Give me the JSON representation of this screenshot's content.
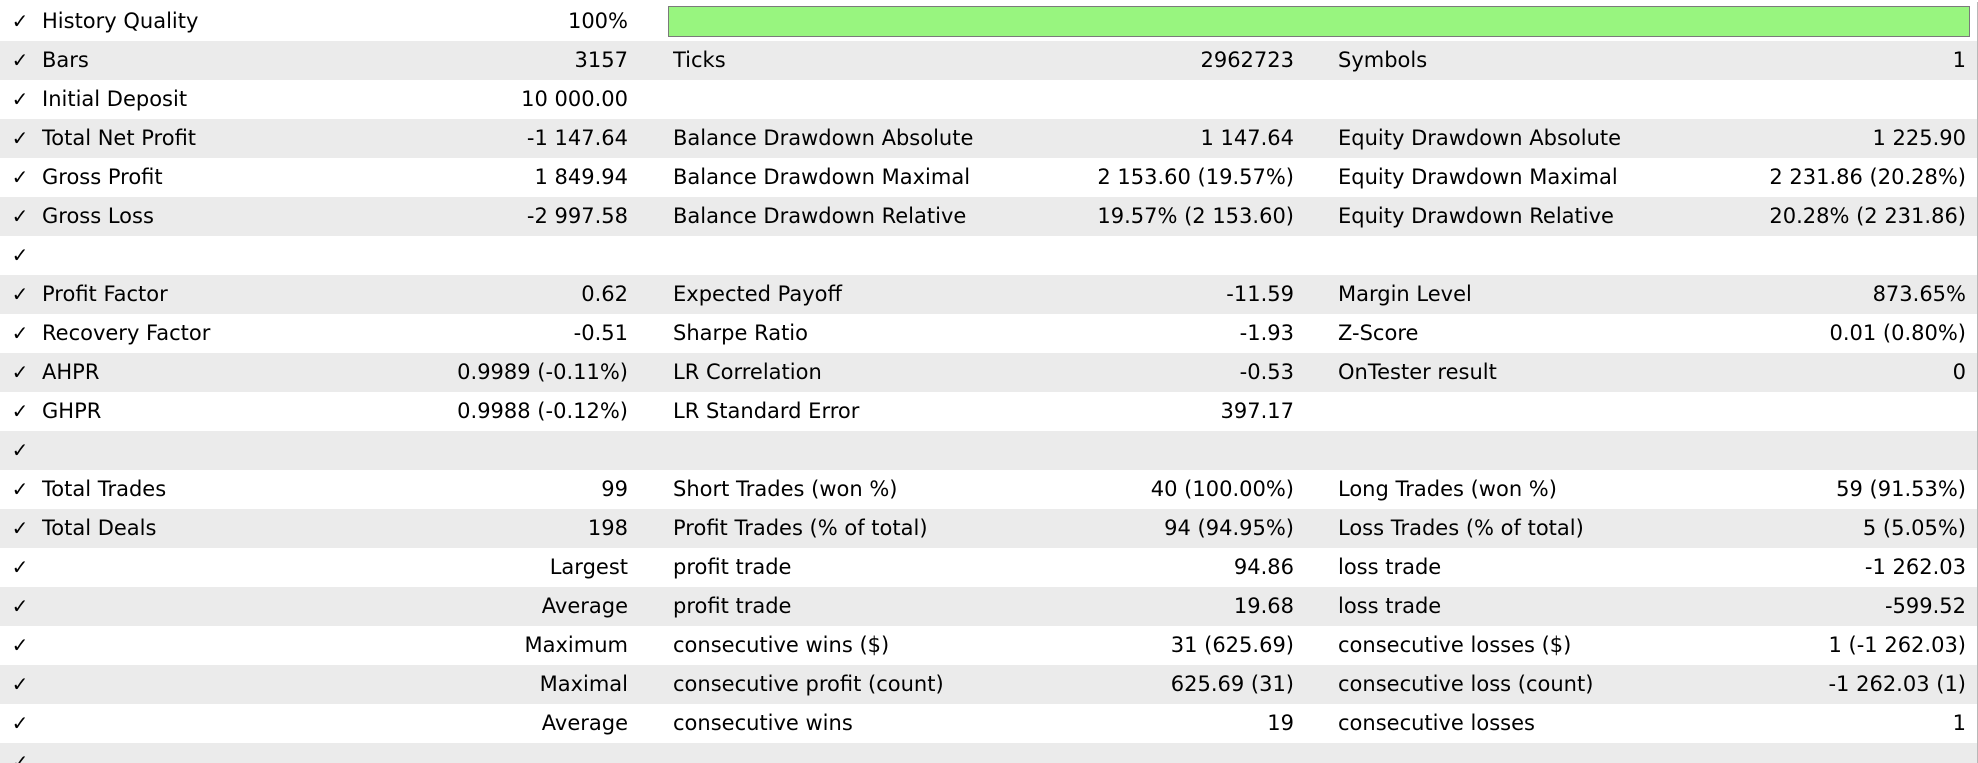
{
  "colors": {
    "row_even": "#ebebeb",
    "row_odd": "#ffffff",
    "quality_fill": "#98f57f"
  },
  "icons": {
    "check": "✓"
  },
  "report": {
    "history_quality": {
      "label": "History Quality",
      "value": "100%",
      "fill_fraction": 1.0
    },
    "bars": {
      "label": "Bars",
      "value": "3157",
      "label2": "Ticks",
      "value2": "2962723",
      "label3": "Symbols",
      "value3": "1"
    },
    "initial_deposit": {
      "label": "Initial Deposit",
      "value": "10 000.00"
    },
    "total_net_profit": {
      "label": "Total Net Profit",
      "value": "-1 147.64",
      "label2": "Balance Drawdown Absolute",
      "value2": "1 147.64",
      "label3": "Equity Drawdown Absolute",
      "value3": "1 225.90"
    },
    "gross_profit": {
      "label": "Gross Profit",
      "value": "1 849.94",
      "label2": "Balance Drawdown Maximal",
      "value2": "2 153.60 (19.57%)",
      "label3": "Equity Drawdown Maximal",
      "value3": "2 231.86 (20.28%)"
    },
    "gross_loss": {
      "label": "Gross Loss",
      "value": "-2 997.58",
      "label2": "Balance Drawdown Relative",
      "value2": "19.57% (2 153.60)",
      "label3": "Equity Drawdown Relative",
      "value3": "20.28% (2 231.86)"
    },
    "profit_factor": {
      "label": "Profit Factor",
      "value": "0.62",
      "label2": "Expected Payoff",
      "value2": "-11.59",
      "label3": "Margin Level",
      "value3": "873.65%"
    },
    "recovery_factor": {
      "label": "Recovery Factor",
      "value": "-0.51",
      "label2": "Sharpe Ratio",
      "value2": "-1.93",
      "label3": "Z-Score",
      "value3": "0.01 (0.80%)"
    },
    "ahpr": {
      "label": "AHPR",
      "value": "0.9989 (-0.11%)",
      "label2": "LR Correlation",
      "value2": "-0.53",
      "label3": "OnTester result",
      "value3": "0"
    },
    "ghpr": {
      "label": "GHPR",
      "value": "0.9988 (-0.12%)",
      "label2": "LR Standard Error",
      "value2": "397.17"
    },
    "total_trades": {
      "label": "Total Trades",
      "value": "99",
      "label2": "Short Trades (won %)",
      "value2": "40 (100.00%)",
      "label3": "Long Trades (won %)",
      "value3": "59 (91.53%)"
    },
    "total_deals": {
      "label": "Total Deals",
      "value": "198",
      "label2": "Profit Trades (% of total)",
      "value2": "94 (94.95%)",
      "label3": "Loss Trades (% of total)",
      "value3": "5 (5.05%)"
    },
    "largest": {
      "prefix": "Largest",
      "label2": "profit trade",
      "value2": "94.86",
      "label3": "loss trade",
      "value3": "-1 262.03"
    },
    "average": {
      "prefix": "Average",
      "label2": "profit trade",
      "value2": "19.68",
      "label3": "loss trade",
      "value3": "-599.52"
    },
    "maximum": {
      "prefix": "Maximum",
      "label2": "consecutive wins ($)",
      "value2": "31 (625.69)",
      "label3": "consecutive losses ($)",
      "value3": "1 (-1 262.03)"
    },
    "maximal": {
      "prefix": "Maximal",
      "label2": "consecutive profit (count)",
      "value2": "625.69 (31)",
      "label3": "consecutive loss (count)",
      "value3": "-1 262.03 (1)"
    },
    "average_consecutive": {
      "prefix": "Average",
      "label2": "consecutive wins",
      "value2": "19",
      "label3": "consecutive losses",
      "value3": "1"
    }
  }
}
